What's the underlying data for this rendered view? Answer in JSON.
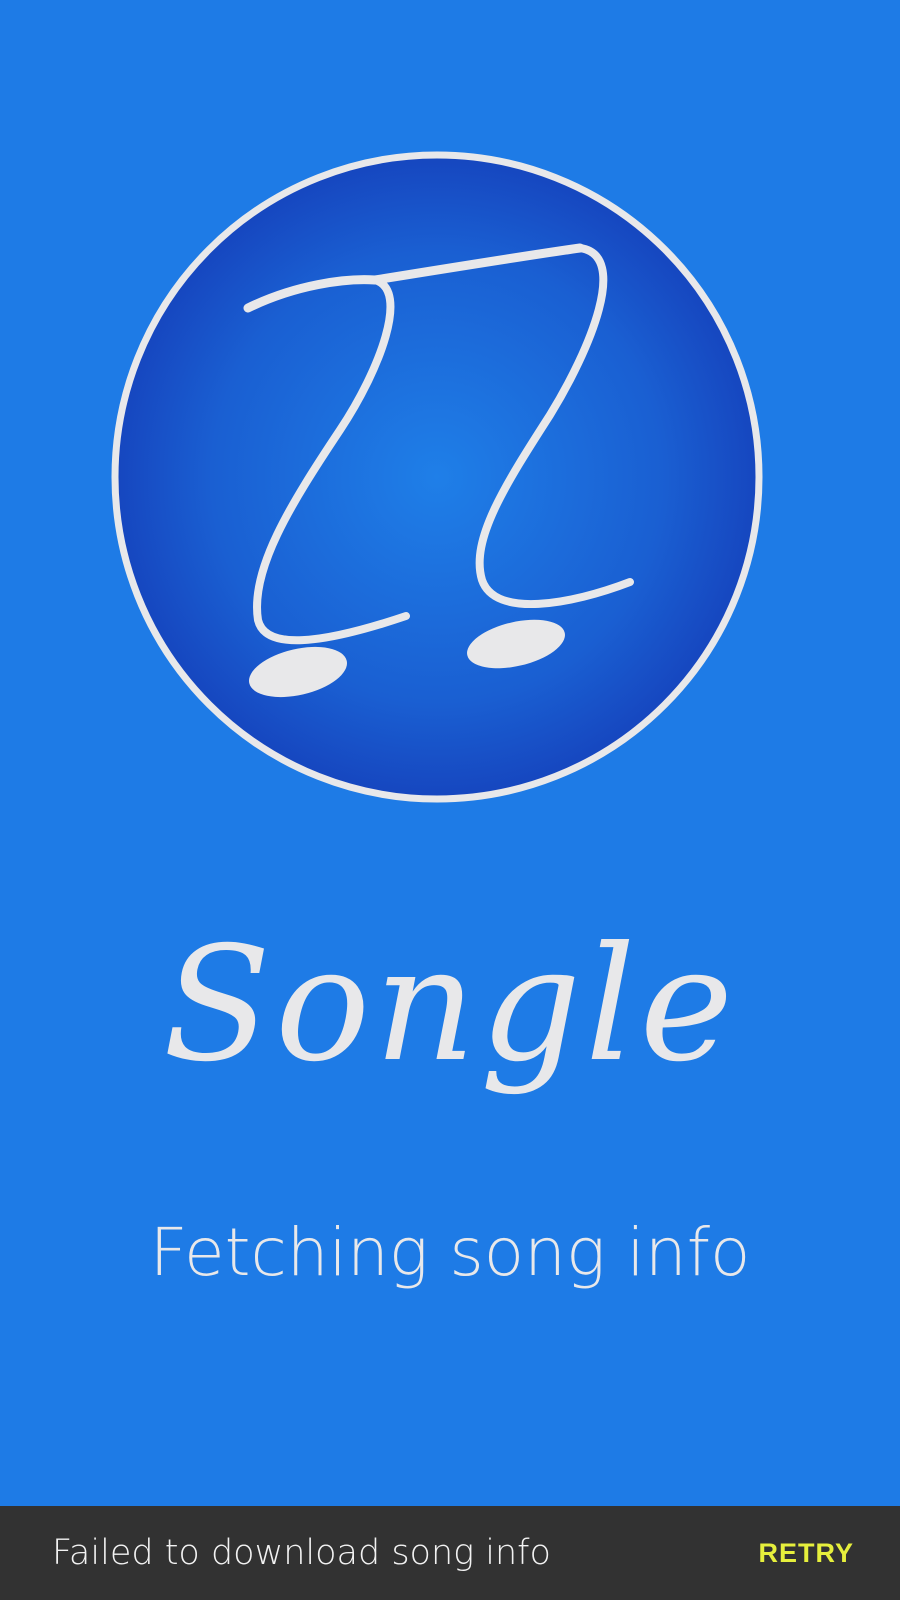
{
  "splash": {
    "logo_icon": "music-notes-icon",
    "app_name": "Songle",
    "status_text": "Fetching song info"
  },
  "snackbar": {
    "message": "Failed to download song info",
    "action_label": "RETRY"
  },
  "colors": {
    "background": "#1e7be6",
    "logo_circle": "#1a59cc",
    "logo_ring": "#e8e8ea",
    "text": "#e8e8ea",
    "snackbar_background": "#323232",
    "snackbar_action": "#e6ef3c"
  }
}
